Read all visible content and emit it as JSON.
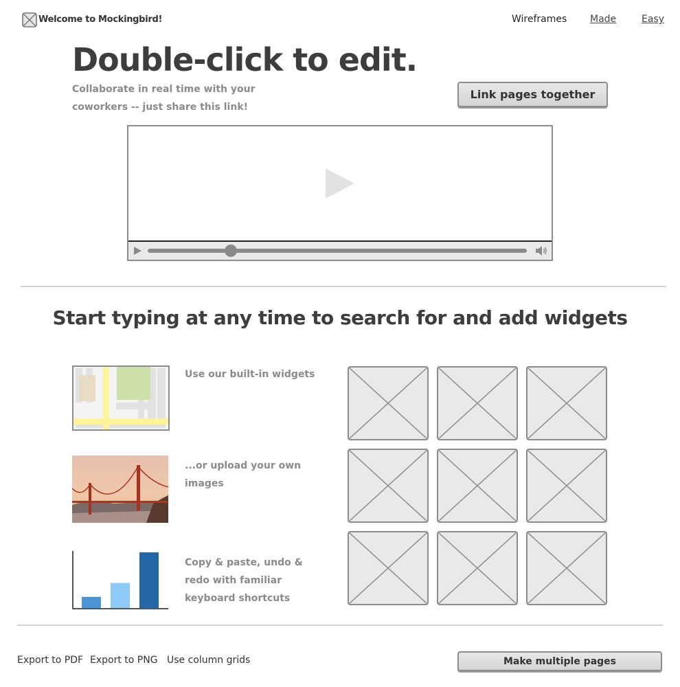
{
  "header": {
    "logo_icon": "placeholder-x-icon",
    "brand": "Welcome to Mockingbird!",
    "nav": [
      "Wireframes",
      "Made",
      "Easy"
    ]
  },
  "hero": {
    "title": "Double-click to edit.",
    "subtitle": "Collaborate in real time with your coworkers -- just share this link!",
    "link_button": "Link pages together"
  },
  "video": {
    "play_icon": "play-icon",
    "volume_icon": "speaker-icon",
    "progress": 0.22
  },
  "widgets": {
    "heading": "Start typing at any time to search for and add widgets",
    "features": [
      {
        "text": "Use our built-in widgets",
        "icon": "map-thumbnail"
      },
      {
        "text": "...or upload your own images",
        "icon": "bridge-photo"
      },
      {
        "text": "Copy & paste, undo & redo with familiar keyboard shortcuts",
        "icon": "bar-chart-thumbnail"
      }
    ],
    "placeholder_count": 9,
    "chart_thumbnail": {
      "values": [
        0.2,
        0.45,
        1.0
      ],
      "colors": [
        "#4a95d6",
        "#8ccaf7",
        "#2467a6"
      ]
    }
  },
  "footer": {
    "links": [
      "Export to PDF",
      "Export to PNG",
      "Use column grids"
    ],
    "pages_button": "Make multiple pages"
  }
}
